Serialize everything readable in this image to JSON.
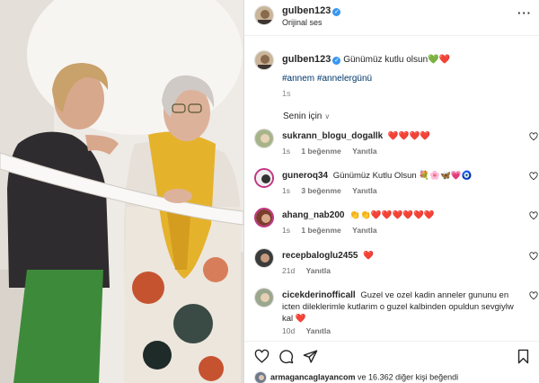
{
  "post": {
    "username": "gulben123",
    "audio": "Orijinal ses",
    "more_icon": "more-options-icon",
    "caption": "Günümüz kutlu olsun",
    "caption_emoji": "💚❤️",
    "hashtags": "#annem #annelergünü",
    "time": "1s"
  },
  "sort_label": "Senin için",
  "comments": [
    {
      "user": "sukrann_blogu_dogallk",
      "text": "❤️❤️❤️❤️",
      "time": "1s",
      "likes": "1 beğenme",
      "reply": "Yanıtla"
    },
    {
      "user": "guneroq34",
      "text": "Günümüz Kutlu Olsun 💐🌸🦋💗🧿",
      "time": "1s",
      "likes": "3 beğenme",
      "reply": "Yanıtla"
    },
    {
      "user": "ahang_nab200",
      "text": "👏👏❤️❤️❤️❤️❤️❤️",
      "time": "1s",
      "likes": "1 beğenme",
      "reply": "Yanıtla"
    },
    {
      "user": "recepbaloglu2455",
      "text": "❤️",
      "time": "21d",
      "likes": "",
      "reply": "Yanıtla"
    },
    {
      "user": "cicekderinofficall",
      "text": "Guzel ve ozel kadin anneler gununu en icten dileklerimle kutlarim o guzel kalbinden opuldun sevgiylw kal ❤️",
      "time": "10d",
      "likes": "",
      "reply": "Yanıtla"
    }
  ],
  "likes_line": {
    "user": "armagancaglayancom",
    "rest": " ve 16.362 diğer kişi beğendi"
  },
  "colors": {
    "link": "#00376b",
    "verified": "#3897f0",
    "muted": "#737373"
  }
}
